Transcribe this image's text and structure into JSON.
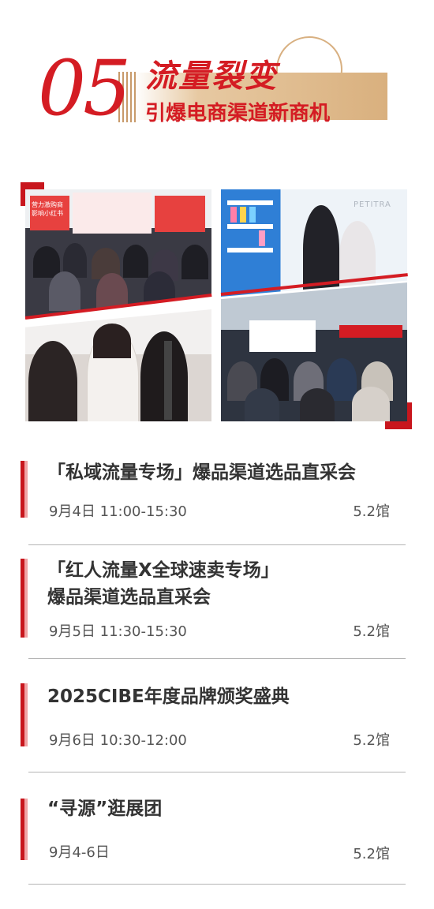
{
  "header": {
    "number": "05",
    "title": "流量裂变",
    "subtitle": "引爆电商渠道新商机",
    "accent_color": "#d41c23",
    "gold_color": "#d9b07e"
  },
  "photos": {
    "photo1_sign": "营力激购商 影响小红书",
    "photo2_brand": "PETITRA"
  },
  "events": [
    {
      "title_lines": [
        "「私域流量专场」爆品渠道选品直采会"
      ],
      "time": "9月4日 11:00-15:30",
      "hall": "5.2馆"
    },
    {
      "title_lines": [
        "「红人流量X全球速卖专场」",
        "爆品渠道选品直采会"
      ],
      "time": "9月5日 11:30-15:30",
      "hall": "5.2馆"
    },
    {
      "title_lines": [
        "2025CIBE年度品牌颁奖盛典"
      ],
      "time": "9月6日 10:30-12:00",
      "hall": "5.2馆"
    },
    {
      "title_lines": [
        "“寻源”逛展团"
      ],
      "time": "9月4-6日",
      "hall": "5.2馆"
    }
  ]
}
